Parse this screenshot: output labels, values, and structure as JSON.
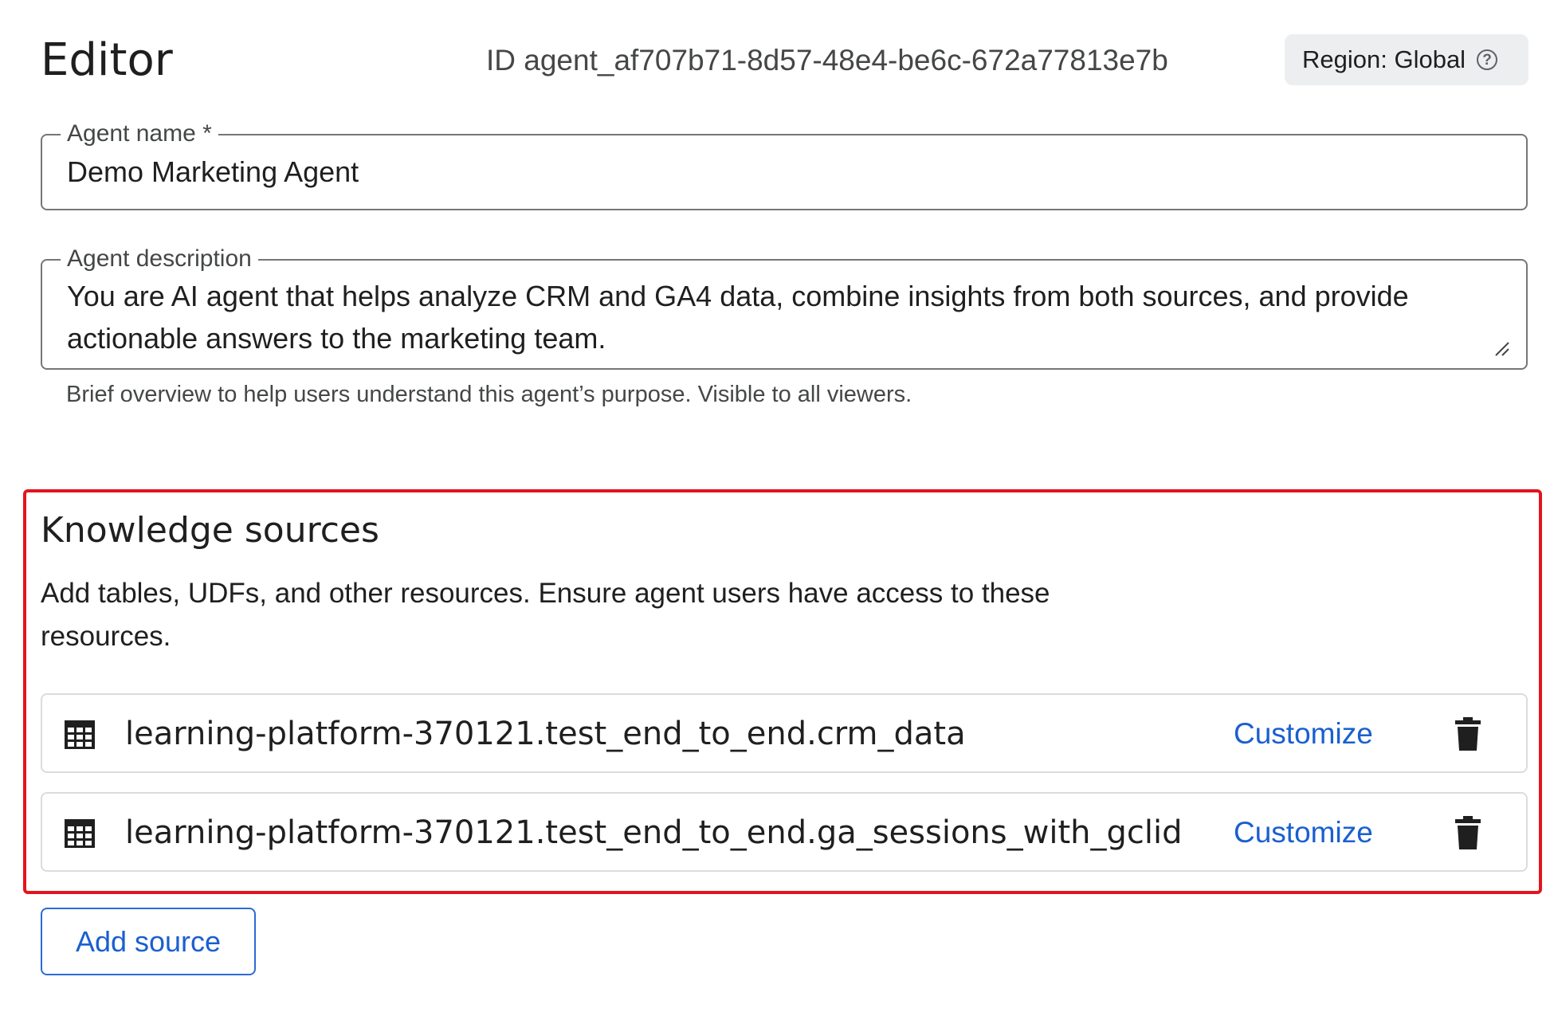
{
  "header": {
    "title": "Editor",
    "agent_id": "ID agent_af707b71-8d57-48e4-be6c-672a77813e7b",
    "region_label": "Region: Global",
    "help_icon_glyph": "?"
  },
  "agent_name": {
    "label": "Agent name *",
    "value": "Demo Marketing Agent"
  },
  "agent_description": {
    "label": "Agent description",
    "value": "You are AI agent that helps analyze CRM and GA4 data, combine insights from both sources, and provide actionable answers to the marketing team.",
    "helper_text": "Brief overview to help users understand this agent’s purpose. Visible to all viewers."
  },
  "knowledge_sources": {
    "title": "Knowledge sources",
    "description": "Add tables, UDFs, and other resources. Ensure agent users have access to these resources.",
    "highlight_color": "#e2141d",
    "sources": [
      {
        "name": "learning-platform-370121.test_end_to_end.crm_data",
        "customize_label": "Customize",
        "icon": "table-icon"
      },
      {
        "name": "learning-platform-370121.test_end_to_end.ga_sessions_with_gclid",
        "customize_label": "Customize",
        "icon": "table-icon"
      }
    ],
    "add_source_label": "Add source"
  },
  "colors": {
    "link": "#1a5fd0",
    "text": "#1f1f1f",
    "secondary_text": "#444746"
  }
}
